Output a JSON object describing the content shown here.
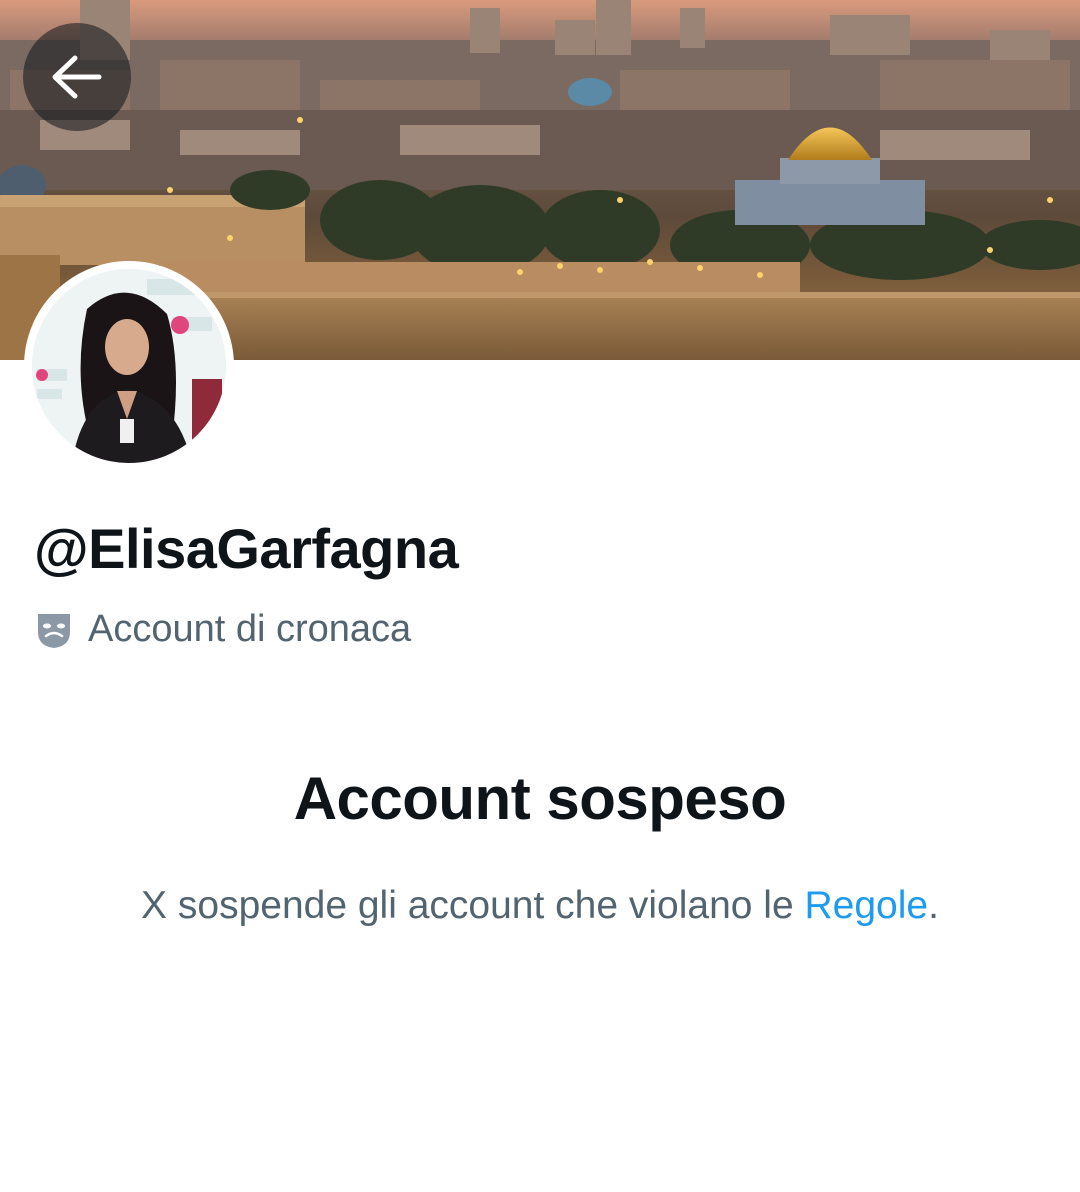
{
  "header": {
    "back_icon": "arrow-left-icon",
    "banner_image": "jerusalem-old-city-skyline-photo"
  },
  "profile": {
    "avatar_image": "woman-portrait-photo",
    "handle": "@ElisaGarfagna",
    "label_icon": "theater-masks-icon",
    "label_text": "Account di cronaca"
  },
  "suspension": {
    "title": "Account sospeso",
    "message_prefix": "X sospende gli account che violano le ",
    "rules_link": "Regole",
    "message_suffix": "."
  },
  "colors": {
    "text_primary": "#0f1419",
    "text_secondary": "#536471",
    "link": "#1d9bf0"
  }
}
